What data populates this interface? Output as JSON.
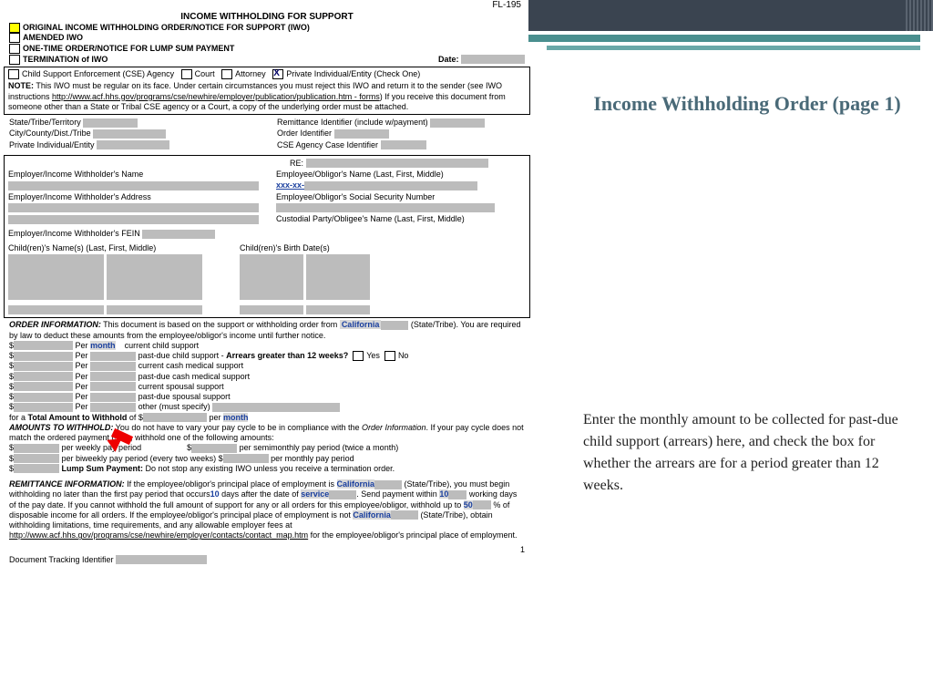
{
  "form_code": "FL-195",
  "title": "INCOME WITHHOLDING FOR SUPPORT",
  "opts": {
    "o1": "ORIGINAL INCOME WITHHOLDING ORDER/NOTICE FOR SUPPORT (IWO)",
    "o2": "AMENDED IWO",
    "o3": "ONE-TIME ORDER/NOTICE FOR LUMP SUM PAYMENT",
    "o4": "TERMINATION of IWO"
  },
  "date": "Date:",
  "rowA": {
    "a": "Child Support Enforcement (CSE) Agency",
    "b": "Court",
    "c": "Attorney",
    "d": "Private Individual/Entity   (Check One)"
  },
  "note_label": "NOTE:",
  "note": " This IWO must be regular on its face. Under certain circumstances you must reject this IWO and return it to the sender (see IWO instructions ",
  "note_link": "http://www.acf.hhs.gov/programs/cse/newhire/employer/publication/publication.htm - forms",
  "note2": ") If you receive this document from someone other than a State or Tribal CSE agency or a Court, a copy of the underlying order must be attached.",
  "f1": {
    "a": "State/Tribe/Territory",
    "b": "Remittance Identifier (include w/payment)",
    "c": "City/County/Dist./Tribe",
    "d": "Order Identifier",
    "e": "Private Individual/Entity",
    "f": "CSE Agency Case Identifier"
  },
  "emp": {
    "a": "Employer/Income Withholder's Name",
    "re": "RE:",
    "b": "Employee/Obligor's Name (Last, First, Middle)",
    "c": "Employer/Income Withholder's Address",
    "ssn": "xxx-xx-",
    "d": "Employee/Obligor's Social Security Number",
    "e": "Custodial Party/Obligee's Name (Last, First, Middle)",
    "f": "Employer/Income Withholder's FEIN"
  },
  "kids": {
    "a": "Child(ren)'s Name(s) (Last, First, Middle)",
    "b": "Child(ren)'s Birth Date(s)"
  },
  "order": {
    "h": "ORDER INFORMATION:",
    "t1": " This document is based on the support or withholding order from ",
    "state": "California",
    "t2": " (State/Tribe). You are required by law to deduct these amounts from the employee/obligor's income until further notice.",
    "per": "Per",
    "month": "month",
    "l1": "current child support",
    "l2": "past-due child support -  ",
    "arr": "Arrears greater than 12 weeks?",
    "yes": "Yes",
    "no": "No",
    "l3": "current cash medical support",
    "l4": "past-due cash medical support",
    "l5": "current spousal support",
    "l6": "past-due spousal support",
    "l7": "other (must specify)",
    "tot": "Total Amount to Withhold",
    "per2": "per",
    "month2": "month",
    "for": "for a ",
    "of": " of $"
  },
  "amt": {
    "h": "AMOUNTS TO WITHHOLD:",
    "t": " You do not have to vary your pay cycle to be in compliance with the ",
    "oi": "Order Information",
    "t2": ". If your pay cycle does not match the ordered payment cycle, withhold one of the following amounts:",
    "a": "per weekly pay period",
    "b": "per semimonthly pay period (twice a month)",
    "c": "per biweekly pay period (every two weeks) $",
    "d": "per monthly pay period",
    "lump": "Lump Sum Payment:",
    "lumpt": " Do not stop any existing IWO unless you receive a termination order."
  },
  "rem": {
    "h": "REMITTANCE INFORMATION:",
    "t1": " If the employee/obligor's principal place of employment is ",
    "cal": "California",
    "st": " (State/Tribe), you must begin withholding no later than the first pay period that occurs",
    "n10": "10",
    "t2": " days after the date of ",
    "svc": "service",
    "t3": ". Send payment within ",
    "n10b": "10",
    "t4": " working days of the pay date. If you cannot withhold the full amount of support for any or all orders for this employee/obligor, withhold up to ",
    "n50": "50",
    "t5": " % of disposable income for all orders. If the employee/obligor's principal place of employment is not ",
    "cal2": "California",
    "t6": " (State/Tribe), obtain withholding limitations, time requirements, and any allowable employer fees at ",
    "link": "http://www.acf.hhs.gov/programs/cse/newhire/employer/contacts/contact_map.htm",
    "t7": " for the employee/obligor's principal place of employment."
  },
  "track": "Document Tracking Identifier",
  "pg": "1",
  "slide": {
    "title": "Income Withholding Order (page 1)",
    "body": "Enter the monthly amount to be collected for past-due child support (arrears) here, and check the box for whether the arrears are for a period greater than 12 weeks."
  }
}
